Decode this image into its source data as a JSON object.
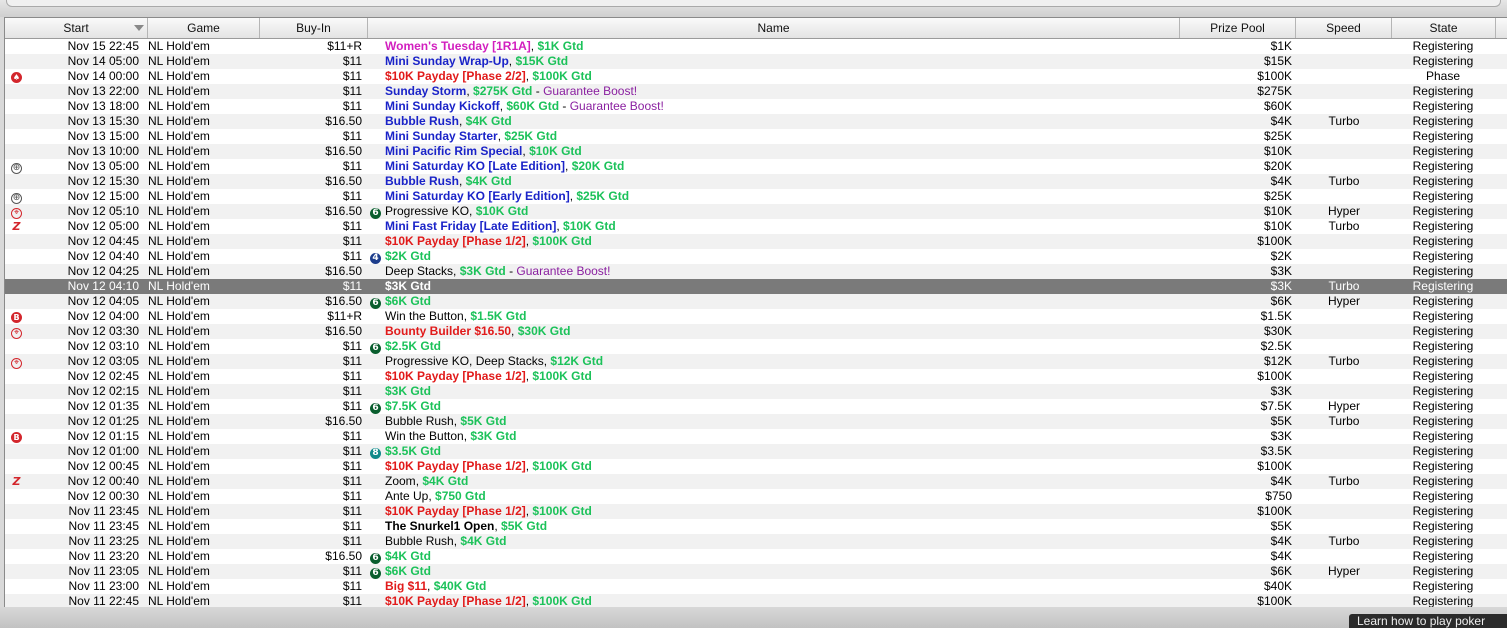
{
  "columns": {
    "start": "Start",
    "game": "Game",
    "buyin": "Buy-In",
    "name": "Name",
    "prize": "Prize Pool",
    "speed": "Speed",
    "state": "State"
  },
  "colors": {
    "pink": "#d21fbf",
    "blue": "#1a23c8",
    "red": "#e11a1a",
    "green": "#1cc25a",
    "purple": "#8a1fa0",
    "selected_row": "#7a7a7a"
  },
  "rows": [
    {
      "start": "Nov 15  22:45",
      "game": "NL Hold'em",
      "buyin": "$11+R",
      "name": [
        [
          "Women's Tuesday [1R1A]",
          "pink"
        ],
        [
          ", ",
          "black"
        ],
        [
          "$1K Gtd",
          "green"
        ]
      ],
      "prize": "$1K",
      "speed": "",
      "state": "Registering"
    },
    {
      "start": "Nov 14  05:00",
      "game": "NL Hold'em",
      "buyin": "$11",
      "name": [
        [
          "Mini Sunday Wrap-Up",
          "blue"
        ],
        [
          ", ",
          "black"
        ],
        [
          "$15K Gtd",
          "green"
        ]
      ],
      "prize": "$15K",
      "speed": "",
      "state": "Registering"
    },
    {
      "icon": "spade-icon",
      "start": "Nov 14  00:00",
      "game": "NL Hold'em",
      "buyin": "$11",
      "name": [
        [
          "$10K Payday [Phase 2/2]",
          "red"
        ],
        [
          ", ",
          "black"
        ],
        [
          "$100K Gtd",
          "green"
        ]
      ],
      "prize": "$100K",
      "speed": "",
      "state": "Phase"
    },
    {
      "start": "Nov 13  22:00",
      "game": "NL Hold'em",
      "buyin": "$11",
      "name": [
        [
          "Sunday Storm",
          "blue"
        ],
        [
          ", ",
          "black"
        ],
        [
          "$275K Gtd",
          "green"
        ],
        [
          " - ",
          "black"
        ],
        [
          "Guarantee Boost!",
          "purple"
        ]
      ],
      "prize": "$275K",
      "speed": "",
      "state": "Registering"
    },
    {
      "start": "Nov 13  18:00",
      "game": "NL Hold'em",
      "buyin": "$11",
      "name": [
        [
          "Mini Sunday Kickoff",
          "blue"
        ],
        [
          ", ",
          "black"
        ],
        [
          "$60K Gtd",
          "green"
        ],
        [
          " - ",
          "black"
        ],
        [
          "Guarantee Boost!",
          "purple"
        ]
      ],
      "prize": "$60K",
      "speed": "",
      "state": "Registering"
    },
    {
      "start": "Nov 13  15:30",
      "game": "NL Hold'em",
      "buyin": "$16.50",
      "name": [
        [
          "Bubble Rush",
          "blue"
        ],
        [
          ", ",
          "black"
        ],
        [
          "$4K Gtd",
          "green"
        ]
      ],
      "prize": "$4K",
      "speed": "Turbo",
      "state": "Registering"
    },
    {
      "start": "Nov 13  15:00",
      "game": "NL Hold'em",
      "buyin": "$11",
      "name": [
        [
          "Mini Sunday Starter",
          "blue"
        ],
        [
          ", ",
          "black"
        ],
        [
          "$25K Gtd",
          "green"
        ]
      ],
      "prize": "$25K",
      "speed": "",
      "state": "Registering"
    },
    {
      "start": "Nov 13  10:00",
      "game": "NL Hold'em",
      "buyin": "$16.50",
      "name": [
        [
          "Mini Pacific Rim Special",
          "blue"
        ],
        [
          ", ",
          "black"
        ],
        [
          "$10K Gtd",
          "green"
        ]
      ],
      "prize": "$10K",
      "speed": "",
      "state": "Registering"
    },
    {
      "icon": "target-icon",
      "start": "Nov 13  05:00",
      "game": "NL Hold'em",
      "buyin": "$11",
      "name": [
        [
          "Mini Saturday KO [Late Edition]",
          "blue"
        ],
        [
          ", ",
          "black"
        ],
        [
          "$20K Gtd",
          "green"
        ]
      ],
      "prize": "$20K",
      "speed": "",
      "state": "Registering"
    },
    {
      "start": "Nov 12  15:30",
      "game": "NL Hold'em",
      "buyin": "$16.50",
      "name": [
        [
          "Bubble Rush",
          "blue"
        ],
        [
          ", ",
          "black"
        ],
        [
          "$4K Gtd",
          "green"
        ]
      ],
      "prize": "$4K",
      "speed": "Turbo",
      "state": "Registering"
    },
    {
      "icon": "target-icon",
      "start": "Nov 12  15:00",
      "game": "NL Hold'em",
      "buyin": "$11",
      "name": [
        [
          "Mini Saturday KO [Early Edition]",
          "blue"
        ],
        [
          ", ",
          "black"
        ],
        [
          "$25K Gtd",
          "green"
        ]
      ],
      "prize": "$25K",
      "speed": "",
      "state": "Registering"
    },
    {
      "icon": "bounty-icon",
      "start": "Nov 12  05:10",
      "game": "NL Hold'em",
      "buyin": "$16.50",
      "badge": "6",
      "badgeColor": "green",
      "name": [
        [
          "Progressive KO",
          "black"
        ],
        [
          ", ",
          "black"
        ],
        [
          "$10K Gtd",
          "green"
        ]
      ],
      "prize": "$10K",
      "speed": "Hyper",
      "state": "Registering"
    },
    {
      "icon": "zoom-icon",
      "start": "Nov 12  05:00",
      "game": "NL Hold'em",
      "buyin": "$11",
      "name": [
        [
          "Mini Fast Friday [Late Edition]",
          "blue"
        ],
        [
          ", ",
          "black"
        ],
        [
          "$10K Gtd",
          "green"
        ]
      ],
      "prize": "$10K",
      "speed": "Turbo",
      "state": "Registering"
    },
    {
      "start": "Nov 12  04:45",
      "game": "NL Hold'em",
      "buyin": "$11",
      "name": [
        [
          "$10K Payday [Phase 1/2]",
          "red"
        ],
        [
          ", ",
          "black"
        ],
        [
          "$100K Gtd",
          "green"
        ]
      ],
      "prize": "$100K",
      "speed": "",
      "state": "Registering"
    },
    {
      "start": "Nov 12  04:40",
      "game": "NL Hold'em",
      "buyin": "$11",
      "badge": "4",
      "badgeColor": "navy",
      "name": [
        [
          "$2K Gtd",
          "green"
        ]
      ],
      "prize": "$2K",
      "speed": "",
      "state": "Registering"
    },
    {
      "start": "Nov 12  04:25",
      "game": "NL Hold'em",
      "buyin": "$16.50",
      "name": [
        [
          "Deep Stacks",
          "black"
        ],
        [
          ", ",
          "black"
        ],
        [
          "$3K Gtd",
          "green"
        ],
        [
          " - ",
          "black"
        ],
        [
          "Guarantee Boost!",
          "purple"
        ]
      ],
      "prize": "$3K",
      "speed": "",
      "state": "Registering"
    },
    {
      "selected": true,
      "start": "Nov 12  04:10",
      "game": "NL Hold'em",
      "buyin": "$11",
      "name": [
        [
          "$3K Gtd",
          "green"
        ]
      ],
      "prize": "$3K",
      "speed": "Turbo",
      "state": "Registering"
    },
    {
      "start": "Nov 12  04:05",
      "game": "NL Hold'em",
      "buyin": "$16.50",
      "badge": "6",
      "badgeColor": "green",
      "name": [
        [
          "$6K Gtd",
          "green"
        ]
      ],
      "prize": "$6K",
      "speed": "Hyper",
      "state": "Registering"
    },
    {
      "icon": "button-b-icon",
      "start": "Nov 12  04:00",
      "game": "NL Hold'em",
      "buyin": "$11+R",
      "name": [
        [
          "Win the Button",
          "black"
        ],
        [
          ", ",
          "black"
        ],
        [
          "$1.5K Gtd",
          "green"
        ]
      ],
      "prize": "$1.5K",
      "speed": "",
      "state": "Registering"
    },
    {
      "icon": "bounty-icon",
      "start": "Nov 12  03:30",
      "game": "NL Hold'em",
      "buyin": "$16.50",
      "name": [
        [
          "Bounty Builder $16.50",
          "red"
        ],
        [
          ", ",
          "black"
        ],
        [
          "$30K Gtd",
          "green"
        ]
      ],
      "prize": "$30K",
      "speed": "",
      "state": "Registering"
    },
    {
      "start": "Nov 12  03:10",
      "game": "NL Hold'em",
      "buyin": "$11",
      "badge": "6",
      "badgeColor": "green",
      "name": [
        [
          "$2.5K Gtd",
          "green"
        ]
      ],
      "prize": "$2.5K",
      "speed": "",
      "state": "Registering"
    },
    {
      "icon": "bounty-icon",
      "start": "Nov 12  03:05",
      "game": "NL Hold'em",
      "buyin": "$11",
      "name": [
        [
          "Progressive KO, Deep Stacks",
          "black"
        ],
        [
          ", ",
          "black"
        ],
        [
          "$12K Gtd",
          "green"
        ]
      ],
      "prize": "$12K",
      "speed": "Turbo",
      "state": "Registering"
    },
    {
      "start": "Nov 12  02:45",
      "game": "NL Hold'em",
      "buyin": "$11",
      "name": [
        [
          "$10K Payday [Phase 1/2]",
          "red"
        ],
        [
          ", ",
          "black"
        ],
        [
          "$100K Gtd",
          "green"
        ]
      ],
      "prize": "$100K",
      "speed": "",
      "state": "Registering"
    },
    {
      "start": "Nov 12  02:15",
      "game": "NL Hold'em",
      "buyin": "$11",
      "name": [
        [
          "$3K Gtd",
          "green"
        ]
      ],
      "prize": "$3K",
      "speed": "",
      "state": "Registering"
    },
    {
      "start": "Nov 12  01:35",
      "game": "NL Hold'em",
      "buyin": "$11",
      "badge": "6",
      "badgeColor": "green",
      "name": [
        [
          "$7.5K Gtd",
          "green"
        ]
      ],
      "prize": "$7.5K",
      "speed": "Hyper",
      "state": "Registering"
    },
    {
      "start": "Nov 12  01:25",
      "game": "NL Hold'em",
      "buyin": "$16.50",
      "name": [
        [
          "Bubble Rush",
          "black"
        ],
        [
          ", ",
          "black"
        ],
        [
          "$5K Gtd",
          "green"
        ]
      ],
      "prize": "$5K",
      "speed": "Turbo",
      "state": "Registering"
    },
    {
      "icon": "button-b-icon",
      "start": "Nov 12  01:15",
      "game": "NL Hold'em",
      "buyin": "$11",
      "name": [
        [
          "Win the Button",
          "black"
        ],
        [
          ", ",
          "black"
        ],
        [
          "$3K Gtd",
          "green"
        ]
      ],
      "prize": "$3K",
      "speed": "",
      "state": "Registering"
    },
    {
      "start": "Nov 12  01:00",
      "game": "NL Hold'em",
      "buyin": "$11",
      "badge": "8",
      "badgeColor": "teal",
      "name": [
        [
          "$3.5K Gtd",
          "green"
        ]
      ],
      "prize": "$3.5K",
      "speed": "",
      "state": "Registering"
    },
    {
      "start": "Nov 12  00:45",
      "game": "NL Hold'em",
      "buyin": "$11",
      "name": [
        [
          "$10K Payday [Phase 1/2]",
          "red"
        ],
        [
          ", ",
          "black"
        ],
        [
          "$100K Gtd",
          "green"
        ]
      ],
      "prize": "$100K",
      "speed": "",
      "state": "Registering"
    },
    {
      "icon": "zoom-icon",
      "start": "Nov 12  00:40",
      "game": "NL Hold'em",
      "buyin": "$11",
      "name": [
        [
          "Zoom",
          "black"
        ],
        [
          ", ",
          "black"
        ],
        [
          "$4K Gtd",
          "green"
        ]
      ],
      "prize": "$4K",
      "speed": "Turbo",
      "state": "Registering"
    },
    {
      "start": "Nov 12  00:30",
      "game": "NL Hold'em",
      "buyin": "$11",
      "name": [
        [
          "Ante Up",
          "black"
        ],
        [
          ", ",
          "black"
        ],
        [
          "$750 Gtd",
          "green"
        ]
      ],
      "prize": "$750",
      "speed": "",
      "state": "Registering"
    },
    {
      "start": "Nov 11  23:45",
      "game": "NL Hold'em",
      "buyin": "$11",
      "name": [
        [
          "$10K Payday [Phase 1/2]",
          "red"
        ],
        [
          ", ",
          "black"
        ],
        [
          "$100K Gtd",
          "green"
        ]
      ],
      "prize": "$100K",
      "speed": "",
      "state": "Registering"
    },
    {
      "start": "Nov 11  23:45",
      "game": "NL Hold'em",
      "buyin": "$11",
      "name": [
        [
          "The Snurkel1 Open",
          "blackb"
        ],
        [
          ", ",
          "black"
        ],
        [
          "$5K Gtd",
          "green"
        ]
      ],
      "prize": "$5K",
      "speed": "",
      "state": "Registering"
    },
    {
      "start": "Nov 11  23:25",
      "game": "NL Hold'em",
      "buyin": "$11",
      "name": [
        [
          "Bubble Rush",
          "black"
        ],
        [
          ", ",
          "black"
        ],
        [
          "$4K Gtd",
          "green"
        ]
      ],
      "prize": "$4K",
      "speed": "Turbo",
      "state": "Registering"
    },
    {
      "start": "Nov 11  23:20",
      "game": "NL Hold'em",
      "buyin": "$16.50",
      "badge": "6",
      "badgeColor": "green",
      "name": [
        [
          "$4K Gtd",
          "green"
        ]
      ],
      "prize": "$4K",
      "speed": "",
      "state": "Registering"
    },
    {
      "start": "Nov 11  23:05",
      "game": "NL Hold'em",
      "buyin": "$11",
      "badge": "6",
      "badgeColor": "green",
      "name": [
        [
          "$6K Gtd",
          "green"
        ]
      ],
      "prize": "$6K",
      "speed": "Hyper",
      "state": "Registering"
    },
    {
      "start": "Nov 11  23:00",
      "game": "NL Hold'em",
      "buyin": "$11",
      "name": [
        [
          "Big $11",
          "red"
        ],
        [
          ", ",
          "black"
        ],
        [
          "$40K Gtd",
          "green"
        ]
      ],
      "prize": "$40K",
      "speed": "",
      "state": "Registering"
    },
    {
      "start": "Nov 11  22:45",
      "game": "NL Hold'em",
      "buyin": "$11",
      "name": [
        [
          "$10K Payday [Phase 1/2]",
          "red"
        ],
        [
          ", ",
          "black"
        ],
        [
          "$100K Gtd",
          "green"
        ]
      ],
      "prize": "$100K",
      "speed": "",
      "state": "Registering"
    }
  ],
  "footer": {
    "learn_text": "Learn how to play poker"
  }
}
